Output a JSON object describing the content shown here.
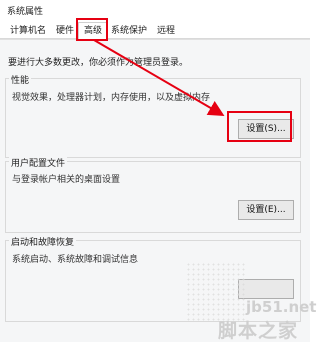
{
  "window": {
    "title": "系统属性"
  },
  "tabs": [
    {
      "label": "计算机名",
      "active": false
    },
    {
      "label": "硬件",
      "active": false
    },
    {
      "label": "高级",
      "active": true
    },
    {
      "label": "系统保护",
      "active": false
    },
    {
      "label": "远程",
      "active": false
    }
  ],
  "notice": "要进行大多数更改，你必须作为管理员登录。",
  "groups": {
    "performance": {
      "title": "性能",
      "description": "视觉效果，处理器计划，内存使用，以及虚拟内存",
      "button_label": "设置(S)..."
    },
    "user_profiles": {
      "title": "用户配置文件",
      "description": "与登录帐户相关的桌面设置",
      "button_label": "设置(E)..."
    },
    "startup_recovery": {
      "title": "启动和故障恢复",
      "description": "系统启动、系统故障和调试信息",
      "button_label": ""
    }
  },
  "annotation_color": "#e60012",
  "watermark": {
    "site": "jb51.net",
    "name": "脚本之家"
  }
}
